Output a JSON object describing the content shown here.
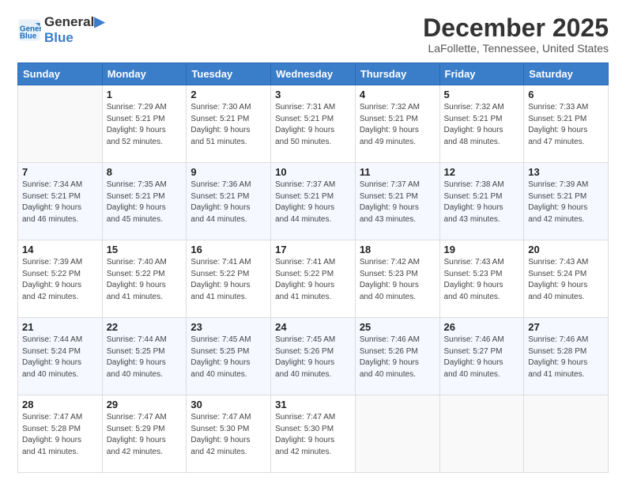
{
  "logo": {
    "line1": "General",
    "line2": "Blue"
  },
  "title": "December 2025",
  "location": "LaFollette, Tennessee, United States",
  "days_header": [
    "Sunday",
    "Monday",
    "Tuesday",
    "Wednesday",
    "Thursday",
    "Friday",
    "Saturday"
  ],
  "weeks": [
    [
      {
        "day": "",
        "info": ""
      },
      {
        "day": "1",
        "info": "Sunrise: 7:29 AM\nSunset: 5:21 PM\nDaylight: 9 hours\nand 52 minutes."
      },
      {
        "day": "2",
        "info": "Sunrise: 7:30 AM\nSunset: 5:21 PM\nDaylight: 9 hours\nand 51 minutes."
      },
      {
        "day": "3",
        "info": "Sunrise: 7:31 AM\nSunset: 5:21 PM\nDaylight: 9 hours\nand 50 minutes."
      },
      {
        "day": "4",
        "info": "Sunrise: 7:32 AM\nSunset: 5:21 PM\nDaylight: 9 hours\nand 49 minutes."
      },
      {
        "day": "5",
        "info": "Sunrise: 7:32 AM\nSunset: 5:21 PM\nDaylight: 9 hours\nand 48 minutes."
      },
      {
        "day": "6",
        "info": "Sunrise: 7:33 AM\nSunset: 5:21 PM\nDaylight: 9 hours\nand 47 minutes."
      }
    ],
    [
      {
        "day": "7",
        "info": "Sunrise: 7:34 AM\nSunset: 5:21 PM\nDaylight: 9 hours\nand 46 minutes."
      },
      {
        "day": "8",
        "info": "Sunrise: 7:35 AM\nSunset: 5:21 PM\nDaylight: 9 hours\nand 45 minutes."
      },
      {
        "day": "9",
        "info": "Sunrise: 7:36 AM\nSunset: 5:21 PM\nDaylight: 9 hours\nand 44 minutes."
      },
      {
        "day": "10",
        "info": "Sunrise: 7:37 AM\nSunset: 5:21 PM\nDaylight: 9 hours\nand 44 minutes."
      },
      {
        "day": "11",
        "info": "Sunrise: 7:37 AM\nSunset: 5:21 PM\nDaylight: 9 hours\nand 43 minutes."
      },
      {
        "day": "12",
        "info": "Sunrise: 7:38 AM\nSunset: 5:21 PM\nDaylight: 9 hours\nand 43 minutes."
      },
      {
        "day": "13",
        "info": "Sunrise: 7:39 AM\nSunset: 5:21 PM\nDaylight: 9 hours\nand 42 minutes."
      }
    ],
    [
      {
        "day": "14",
        "info": "Sunrise: 7:39 AM\nSunset: 5:22 PM\nDaylight: 9 hours\nand 42 minutes."
      },
      {
        "day": "15",
        "info": "Sunrise: 7:40 AM\nSunset: 5:22 PM\nDaylight: 9 hours\nand 41 minutes."
      },
      {
        "day": "16",
        "info": "Sunrise: 7:41 AM\nSunset: 5:22 PM\nDaylight: 9 hours\nand 41 minutes."
      },
      {
        "day": "17",
        "info": "Sunrise: 7:41 AM\nSunset: 5:22 PM\nDaylight: 9 hours\nand 41 minutes."
      },
      {
        "day": "18",
        "info": "Sunrise: 7:42 AM\nSunset: 5:23 PM\nDaylight: 9 hours\nand 40 minutes."
      },
      {
        "day": "19",
        "info": "Sunrise: 7:43 AM\nSunset: 5:23 PM\nDaylight: 9 hours\nand 40 minutes."
      },
      {
        "day": "20",
        "info": "Sunrise: 7:43 AM\nSunset: 5:24 PM\nDaylight: 9 hours\nand 40 minutes."
      }
    ],
    [
      {
        "day": "21",
        "info": "Sunrise: 7:44 AM\nSunset: 5:24 PM\nDaylight: 9 hours\nand 40 minutes."
      },
      {
        "day": "22",
        "info": "Sunrise: 7:44 AM\nSunset: 5:25 PM\nDaylight: 9 hours\nand 40 minutes."
      },
      {
        "day": "23",
        "info": "Sunrise: 7:45 AM\nSunset: 5:25 PM\nDaylight: 9 hours\nand 40 minutes."
      },
      {
        "day": "24",
        "info": "Sunrise: 7:45 AM\nSunset: 5:26 PM\nDaylight: 9 hours\nand 40 minutes."
      },
      {
        "day": "25",
        "info": "Sunrise: 7:46 AM\nSunset: 5:26 PM\nDaylight: 9 hours\nand 40 minutes."
      },
      {
        "day": "26",
        "info": "Sunrise: 7:46 AM\nSunset: 5:27 PM\nDaylight: 9 hours\nand 40 minutes."
      },
      {
        "day": "27",
        "info": "Sunrise: 7:46 AM\nSunset: 5:28 PM\nDaylight: 9 hours\nand 41 minutes."
      }
    ],
    [
      {
        "day": "28",
        "info": "Sunrise: 7:47 AM\nSunset: 5:28 PM\nDaylight: 9 hours\nand 41 minutes."
      },
      {
        "day": "29",
        "info": "Sunrise: 7:47 AM\nSunset: 5:29 PM\nDaylight: 9 hours\nand 42 minutes."
      },
      {
        "day": "30",
        "info": "Sunrise: 7:47 AM\nSunset: 5:30 PM\nDaylight: 9 hours\nand 42 minutes."
      },
      {
        "day": "31",
        "info": "Sunrise: 7:47 AM\nSunset: 5:30 PM\nDaylight: 9 hours\nand 42 minutes."
      },
      {
        "day": "",
        "info": ""
      },
      {
        "day": "",
        "info": ""
      },
      {
        "day": "",
        "info": ""
      }
    ]
  ]
}
